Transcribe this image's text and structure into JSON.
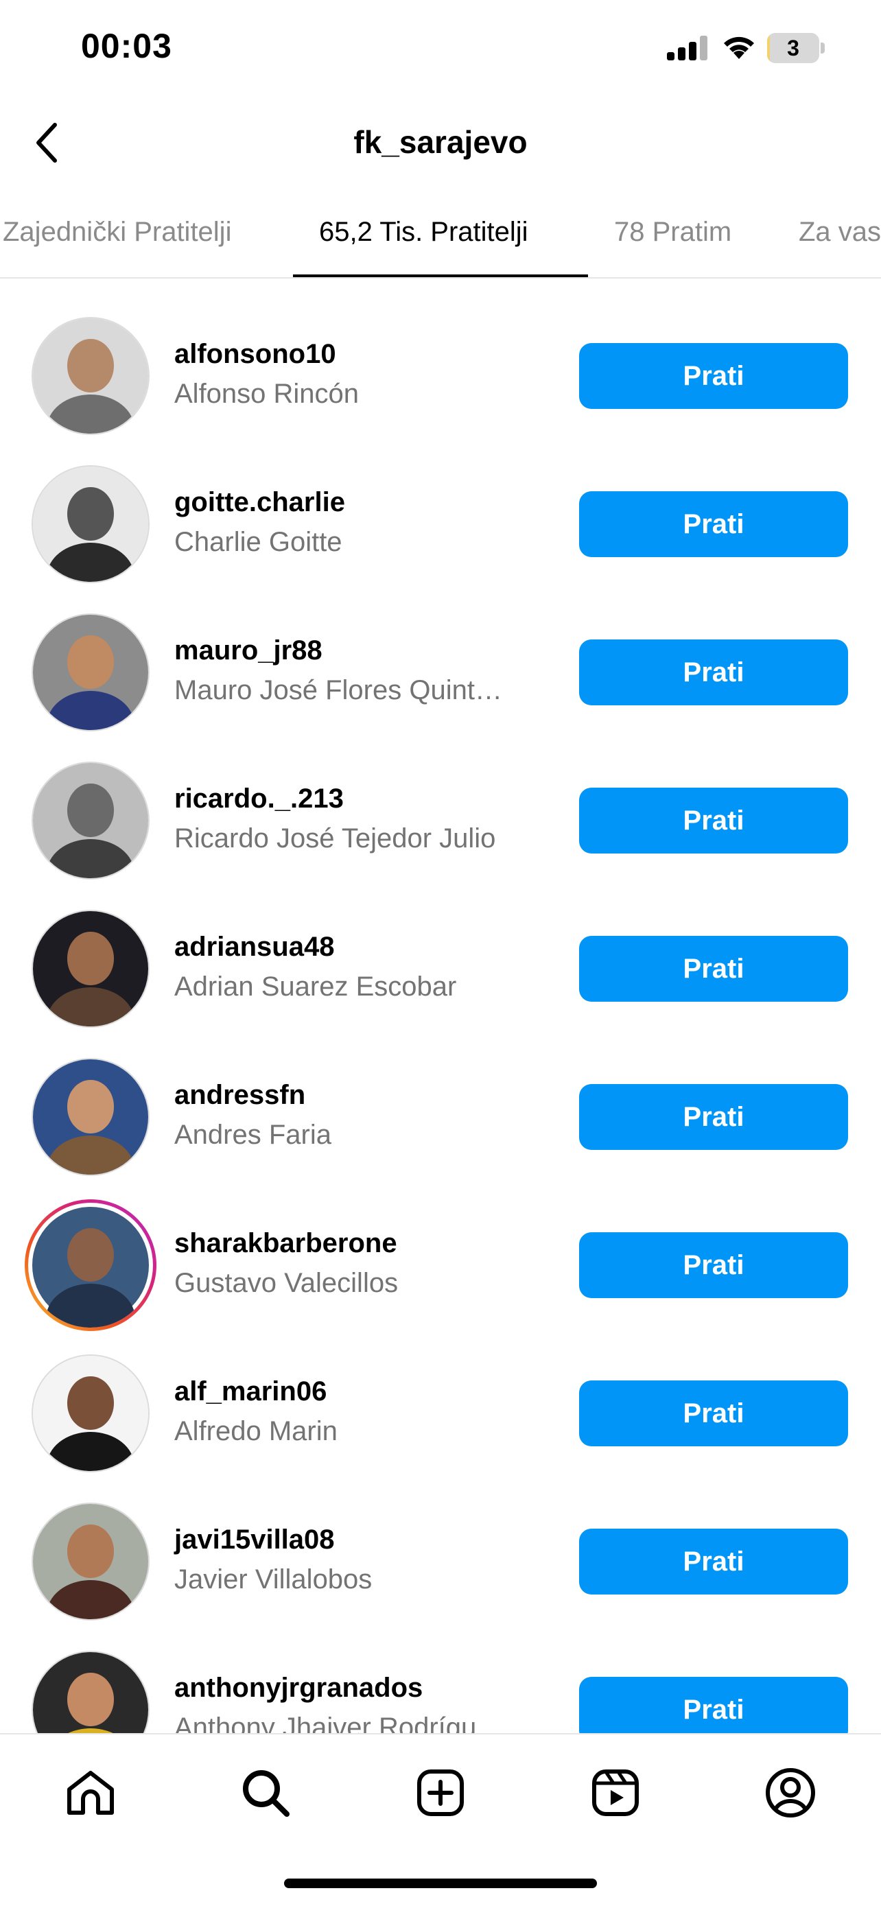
{
  "status_bar": {
    "time": "00:03",
    "battery_level": "3",
    "battery_fraction": 0.03
  },
  "header": {
    "title": "fk_sarajevo",
    "back_icon": "chevron-left-icon"
  },
  "tabs": [
    {
      "label": "Zajednički Pratitelji",
      "active": false
    },
    {
      "label": "65,2 Tis. Pratitelji",
      "active": true
    },
    {
      "label": "78 Pratim",
      "active": false
    },
    {
      "label": "Za vas",
      "active": false
    }
  ],
  "followers": [
    {
      "username": "alfonsono10",
      "full_name": "Alfonso Rincón",
      "button": "Prati"
    },
    {
      "username": "goitte.charlie",
      "full_name": "Charlie Goitte",
      "button": "Prati"
    },
    {
      "username": "mauro_jr88",
      "full_name": "Mauro José Flores Quint…",
      "button": "Prati"
    },
    {
      "username": "ricardo._.213",
      "full_name": "Ricardo José Tejedor Julio",
      "button": "Prati"
    },
    {
      "username": "adriansua48",
      "full_name": "Adrian Suarez Escobar",
      "button": "Prati"
    },
    {
      "username": "andressfn",
      "full_name": "Andres Faria",
      "button": "Prati"
    },
    {
      "username": "sharakbarberone",
      "full_name": "Gustavo Valecillos",
      "button": "Prati"
    },
    {
      "username": "alf_marin06",
      "full_name": "Alfredo Marin",
      "button": "Prati"
    },
    {
      "username": "javi15villa08",
      "full_name": "Javier Villalobos",
      "button": "Prati"
    },
    {
      "username": "anthonyjrgranados",
      "full_name": "Anthony Jhaiver Rodrígu",
      "button": "Prati"
    }
  ],
  "bottom_nav": [
    {
      "name": "home",
      "icon": "home-icon"
    },
    {
      "name": "search",
      "icon": "search-icon"
    },
    {
      "name": "create",
      "icon": "plus-square-icon"
    },
    {
      "name": "reels",
      "icon": "reels-icon"
    },
    {
      "name": "profile",
      "icon": "profile-icon"
    }
  ],
  "colors": {
    "accent": "#0095f6",
    "secondary_text": "#737373"
  }
}
